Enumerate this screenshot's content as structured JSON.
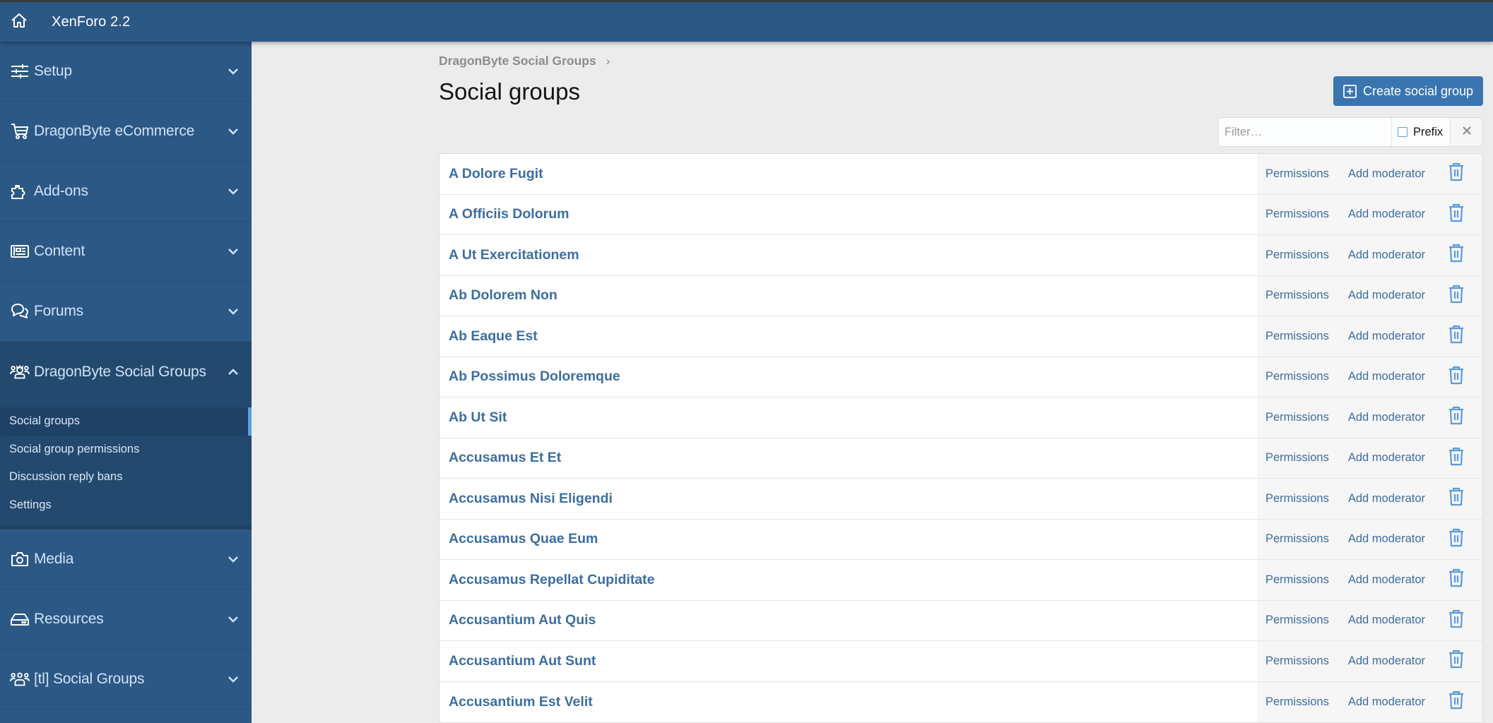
{
  "header": {
    "title": "XenForo 2.2",
    "home_icon": "home-icon"
  },
  "sidebar": {
    "sections": [
      {
        "label": "Setup",
        "icon": "sliders-icon",
        "expanded": false
      },
      {
        "label": "DragonByte eCommerce",
        "icon": "cart-icon",
        "expanded": false
      },
      {
        "label": "Add-ons",
        "icon": "puzzle-icon",
        "expanded": false
      },
      {
        "label": "Content",
        "icon": "newspaper-icon",
        "expanded": false
      },
      {
        "label": "Forums",
        "icon": "comments-icon",
        "expanded": false
      },
      {
        "label": "DragonByte Social Groups",
        "icon": "users-crown-icon",
        "expanded": true,
        "items": [
          {
            "label": "Social groups",
            "active": true
          },
          {
            "label": "Social group permissions",
            "active": false
          },
          {
            "label": "Discussion reply bans",
            "active": false
          },
          {
            "label": "Settings",
            "active": false
          }
        ]
      },
      {
        "label": "Media",
        "icon": "camera-icon",
        "expanded": false
      },
      {
        "label": "Resources",
        "icon": "hdd-icon",
        "expanded": false
      },
      {
        "label": "[tl] Social Groups",
        "icon": "users-icon",
        "expanded": false
      }
    ]
  },
  "main": {
    "breadcrumb": [
      "DragonByte Social Groups"
    ],
    "page_title": "Social groups",
    "create_button": "Create social group",
    "filter": {
      "placeholder": "Filter…",
      "value": "",
      "prefix_label": "Prefix",
      "prefix_checked": false
    },
    "row_actions": {
      "permissions": "Permissions",
      "add_moderator": "Add moderator"
    },
    "groups": [
      "A Dolore Fugit",
      "A Officiis Dolorum",
      "A Ut Exercitationem",
      "Ab Dolorem Non",
      "Ab Eaque Est",
      "Ab Possimus Doloremque",
      "Ab Ut Sit",
      "Accusamus Et Et",
      "Accusamus Nisi Eligendi",
      "Accusamus Quae Eum",
      "Accusamus Repellat Cupiditate",
      "Accusantium Aut Quis",
      "Accusantium Aut Sunt",
      "Accusantium Est Velit"
    ]
  },
  "colors": {
    "header_bg": "#2c5885",
    "sidebar_bg": "#2c5885",
    "sidebar_open_bg": "#24496f",
    "active_accent": "#5e9ee0",
    "link": "#3d6e9f",
    "button_bg": "#3a75b0",
    "page_bg": "#ececec"
  }
}
